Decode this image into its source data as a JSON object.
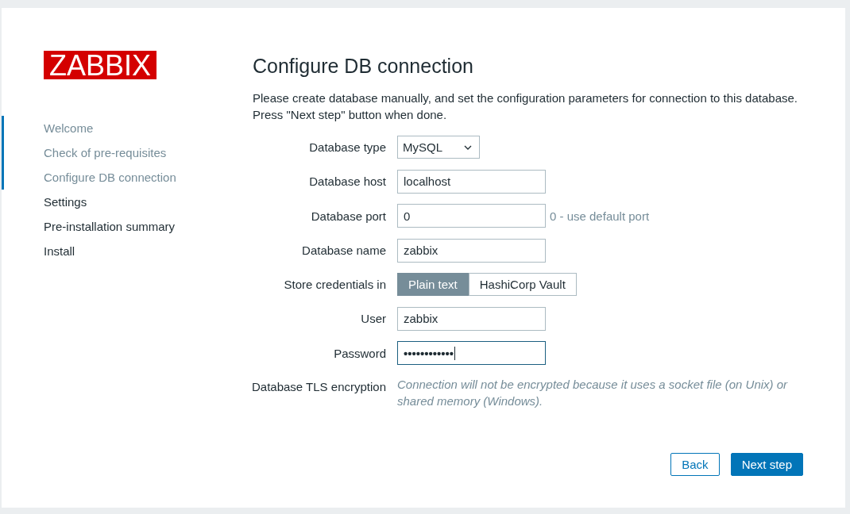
{
  "logo": {
    "text": "ZABBIX"
  },
  "steps": [
    {
      "label": "Welcome",
      "done": true
    },
    {
      "label": "Check of pre-requisites",
      "done": true
    },
    {
      "label": "Configure DB connection",
      "done": true
    },
    {
      "label": "Settings",
      "done": false
    },
    {
      "label": "Pre-installation summary",
      "done": false
    },
    {
      "label": "Install",
      "done": false
    }
  ],
  "page": {
    "title": "Configure DB connection",
    "description": [
      "Please create database manually, and set the configuration parameters for connection to this database.",
      "Press \"Next step\" button when done."
    ]
  },
  "form": {
    "rows": [
      {
        "label": "Database type",
        "kind": "select",
        "value": "MySQL"
      },
      {
        "label": "Database host",
        "kind": "text",
        "value": "localhost",
        "focused": false
      },
      {
        "label": "Database port",
        "kind": "text",
        "value": "0",
        "focused": false,
        "hint": "0 - use default port"
      },
      {
        "label": "Database name",
        "kind": "text",
        "value": "zabbix",
        "focused": false
      },
      {
        "label": "Store credentials in",
        "kind": "segmented",
        "options": [
          {
            "label": "Plain text",
            "selected": true
          },
          {
            "label": "HashiCorp Vault",
            "selected": false
          }
        ]
      },
      {
        "label": "User",
        "kind": "text",
        "value": "zabbix",
        "focused": false
      },
      {
        "label": "Password",
        "kind": "password",
        "value": "••••••••••••",
        "focused": true
      },
      {
        "label": "Database TLS encryption",
        "kind": "note",
        "text": "Connection will not be encrypted because it uses a socket file (on Unix) or shared memory (Windows)."
      }
    ]
  },
  "buttons": [
    {
      "label": "Back",
      "kind": "secondary"
    },
    {
      "label": "Next step",
      "kind": "primary"
    }
  ]
}
